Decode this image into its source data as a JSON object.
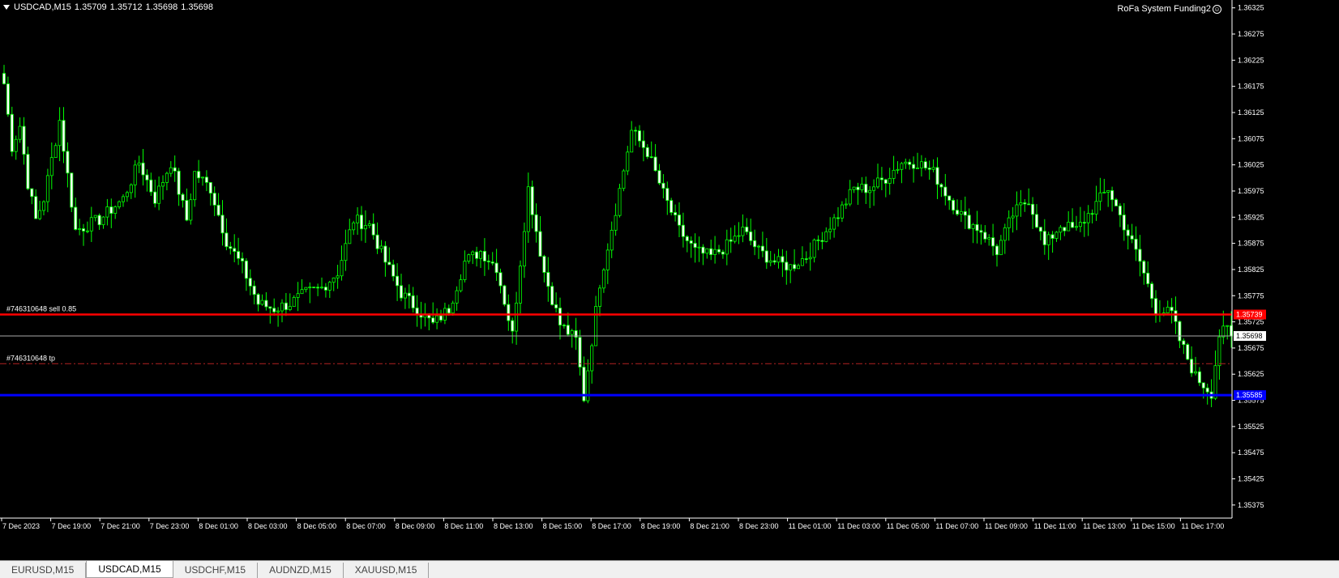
{
  "title": {
    "symbol": "USDCAD,M15",
    "open": "1.35709",
    "high": "1.35712",
    "low": "1.35698",
    "close": "1.35698"
  },
  "ea_name": "RoFa System Funding2",
  "tabs": [
    {
      "label": "EURUSD,M15",
      "active": false
    },
    {
      "label": "USDCAD,M15",
      "active": true
    },
    {
      "label": "USDCHF,M15",
      "active": false
    },
    {
      "label": "AUDNZD,M15",
      "active": false
    },
    {
      "label": "XAUUSD,M15",
      "active": false
    }
  ],
  "chart_data": {
    "type": "candlestick",
    "symbol": "USDCAD",
    "timeframe": "M15",
    "ylim": [
      1.3535,
      1.3634
    ],
    "y_ticks": [
      "1.36325",
      "1.36275",
      "1.36225",
      "1.36175",
      "1.36125",
      "1.36075",
      "1.36025",
      "1.35975",
      "1.35925",
      "1.35875",
      "1.35825",
      "1.35775",
      "1.35725",
      "1.35675",
      "1.35625",
      "1.35575",
      "1.35525",
      "1.35475",
      "1.35425",
      "1.35375"
    ],
    "x_ticks": [
      "7 Dec 2023",
      "7 Dec 19:00",
      "7 Dec 21:00",
      "7 Dec 23:00",
      "8 Dec 01:00",
      "8 Dec 03:00",
      "8 Dec 05:00",
      "8 Dec 07:00",
      "8 Dec 09:00",
      "8 Dec 11:00",
      "8 Dec 13:00",
      "8 Dec 15:00",
      "8 Dec 17:00",
      "8 Dec 19:00",
      "8 Dec 21:00",
      "8 Dec 23:00",
      "11 Dec 01:00",
      "11 Dec 03:00",
      "11 Dec 05:00",
      "11 Dec 07:00",
      "11 Dec 09:00",
      "11 Dec 11:00",
      "11 Dec 13:00",
      "11 Dec 15:00",
      "11 Dec 17:00"
    ],
    "anchors": [
      [
        0,
        1.3618
      ],
      [
        2,
        1.3606
      ],
      [
        4,
        1.361
      ],
      [
        6,
        1.3599
      ],
      [
        8,
        1.3592
      ],
      [
        10,
        1.3596
      ],
      [
        14,
        1.3611
      ],
      [
        18,
        1.359
      ],
      [
        24,
        1.3592
      ],
      [
        30,
        1.3596
      ],
      [
        34,
        1.3603
      ],
      [
        38,
        1.3596
      ],
      [
        42,
        1.3603
      ],
      [
        46,
        1.3592
      ],
      [
        48,
        1.3601
      ],
      [
        52,
        1.3598
      ],
      [
        56,
        1.3588
      ],
      [
        60,
        1.3583
      ],
      [
        64,
        1.3576
      ],
      [
        68,
        1.3575
      ],
      [
        72,
        1.3576
      ],
      [
        76,
        1.3578
      ],
      [
        80,
        1.3579
      ],
      [
        84,
        1.3582
      ],
      [
        88,
        1.3592
      ],
      [
        92,
        1.3591
      ],
      [
        96,
        1.3584
      ],
      [
        100,
        1.3578
      ],
      [
        104,
        1.3575
      ],
      [
        108,
        1.3572
      ],
      [
        112,
        1.3575
      ],
      [
        116,
        1.3584
      ],
      [
        120,
        1.3586
      ],
      [
        124,
        1.3583
      ],
      [
        128,
        1.357
      ],
      [
        132,
        1.3598
      ],
      [
        136,
        1.3582
      ],
      [
        140,
        1.3572
      ],
      [
        144,
        1.3569
      ],
      [
        146,
        1.3558
      ],
      [
        150,
        1.358
      ],
      [
        154,
        1.3594
      ],
      [
        158,
        1.3609
      ],
      [
        162,
        1.3605
      ],
      [
        166,
        1.3597
      ],
      [
        170,
        1.359
      ],
      [
        174,
        1.3586
      ],
      [
        178,
        1.3585
      ],
      [
        182,
        1.3587
      ],
      [
        186,
        1.359
      ],
      [
        190,
        1.3586
      ],
      [
        194,
        1.3584
      ],
      [
        198,
        1.3583
      ],
      [
        202,
        1.3585
      ],
      [
        206,
        1.3589
      ],
      [
        210,
        1.3593
      ],
      [
        214,
        1.3598
      ],
      [
        218,
        1.3598
      ],
      [
        222,
        1.36
      ],
      [
        226,
        1.3603
      ],
      [
        230,
        1.3603
      ],
      [
        234,
        1.3601
      ],
      [
        238,
        1.3596
      ],
      [
        242,
        1.3592
      ],
      [
        246,
        1.359
      ],
      [
        250,
        1.3586
      ],
      [
        254,
        1.3593
      ],
      [
        258,
        1.3596
      ],
      [
        262,
        1.3587
      ],
      [
        266,
        1.3591
      ],
      [
        270,
        1.359
      ],
      [
        274,
        1.3594
      ],
      [
        278,
        1.3598
      ],
      [
        282,
        1.3591
      ],
      [
        286,
        1.3584
      ],
      [
        290,
        1.3575
      ],
      [
        294,
        1.3574
      ],
      [
        296,
        1.3569
      ],
      [
        300,
        1.3562
      ],
      [
        304,
        1.3559
      ],
      [
        306,
        1.357
      ],
      [
        308,
        1.3571
      ],
      [
        309,
        1.35698
      ]
    ],
    "lines": {
      "sell_level": {
        "price": 1.35739,
        "label": "#746310648 sell 0.85",
        "color": "#ff0000"
      },
      "tp_level": {
        "price": 1.35645,
        "label": "#746310648 tp",
        "color": "#b22222"
      },
      "bid_line": {
        "price": 1.35698,
        "color": "#aaaaaa"
      },
      "support_line": {
        "price": 1.35585,
        "color": "#0000ff"
      }
    },
    "price_boxes": {
      "sell": "1.35739",
      "current": "1.35698",
      "support": "1.35585"
    },
    "colors": {
      "bull": "#000000",
      "bear": "#ffffff",
      "wick": "#00ff00",
      "background": "#000000",
      "grid": "none"
    }
  }
}
